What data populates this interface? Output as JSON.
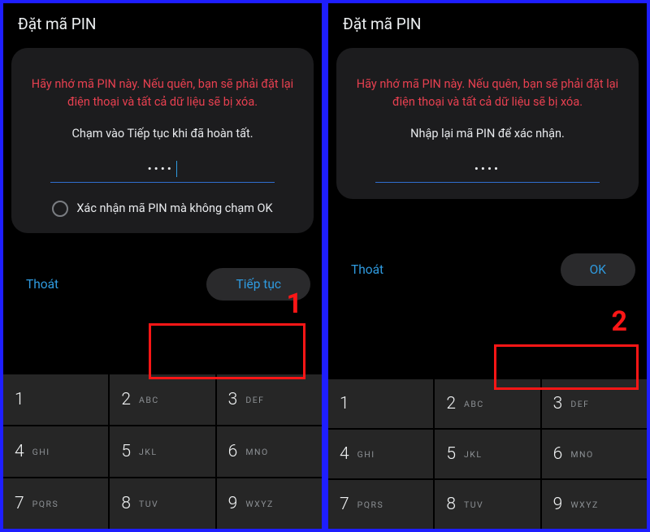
{
  "panel1": {
    "title": "Đặt mã PIN",
    "warning": "Hãy nhớ mã PIN này. Nếu quên, bạn sẽ phải đặt lại điện thoại và tất cả dữ liệu sẽ bị xóa.",
    "instruction": "Chạm vào Tiếp tục khi đã hoàn tất.",
    "pin_masked": "••••",
    "option_label": "Xác nhận mã PIN mà không chạm OK",
    "step_num": "1",
    "exit_label": "Thoát",
    "continue_label": "Tiếp tục"
  },
  "panel2": {
    "title": "Đặt mã PIN",
    "warning": "Hãy nhớ mã PIN này. Nếu quên, bạn sẽ phải đặt lại điện thoại và tất cả dữ liệu sẽ bị xóa.",
    "instruction": "Nhập lại mã PIN để xác nhận.",
    "pin_masked": "••••",
    "step_num": "2",
    "exit_label": "Thoát",
    "continue_label": "OK"
  },
  "keypad": [
    {
      "d": "1",
      "l": ""
    },
    {
      "d": "2",
      "l": "ABC"
    },
    {
      "d": "3",
      "l": "DEF"
    },
    {
      "d": "4",
      "l": "GHI"
    },
    {
      "d": "5",
      "l": "JKL"
    },
    {
      "d": "6",
      "l": "MNO"
    },
    {
      "d": "7",
      "l": "PQRS"
    },
    {
      "d": "8",
      "l": "TUV"
    },
    {
      "d": "9",
      "l": "WXYZ"
    }
  ],
  "colors": {
    "frame": "#1e1eff",
    "accent": "#2f9be0",
    "warning": "#e74050",
    "highlight": "#fb1616"
  }
}
